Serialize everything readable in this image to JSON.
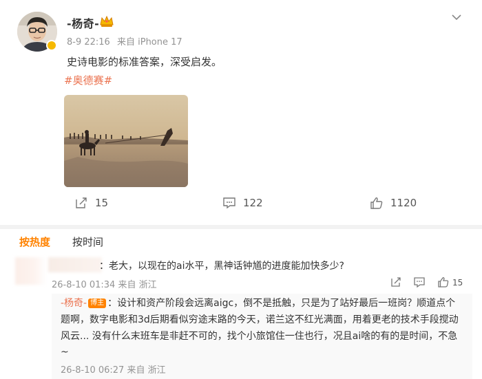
{
  "post": {
    "author": "-杨奇-",
    "timestamp": "8-9 22:16",
    "source": "来自 iPhone 17",
    "text": "史诗电影的标准答案，深受启发。",
    "hashtag": "#奥德赛#",
    "image_alt": "desert-horse-rider-image",
    "actions": {
      "repost_count": "15",
      "comment_count": "122",
      "like_count": "1120"
    }
  },
  "tabs": {
    "hot": "按热度",
    "time": "按时间"
  },
  "comment": {
    "text": "：老大，以现在的ai水平，黑神话钟馗的进度能加快多少?",
    "meta": "26-8-10 01:34 来自 浙江",
    "like_count": "15"
  },
  "reply": {
    "author": "-杨奇-",
    "badge": "博主",
    "line1": "：设计和资产阶段会远离aigc，倒不是抵触，只是为了站好最后一班岗？顺道点个",
    "line2": "题啊，数字电影和3d后期看似穷途末路的今天，诺兰这不红光满面，用着更老的技术手段搅动",
    "line3": "风云... 没有什么末班车是非赶不可的，找个小旅馆住一住也行，况且ai啥的有的是时间，不急",
    "line4": "~",
    "meta": "26-8-10 06:27 来自 浙江"
  },
  "colors": {
    "accent": "#ff8200",
    "link": "#eb7350",
    "muted": "#939393"
  }
}
